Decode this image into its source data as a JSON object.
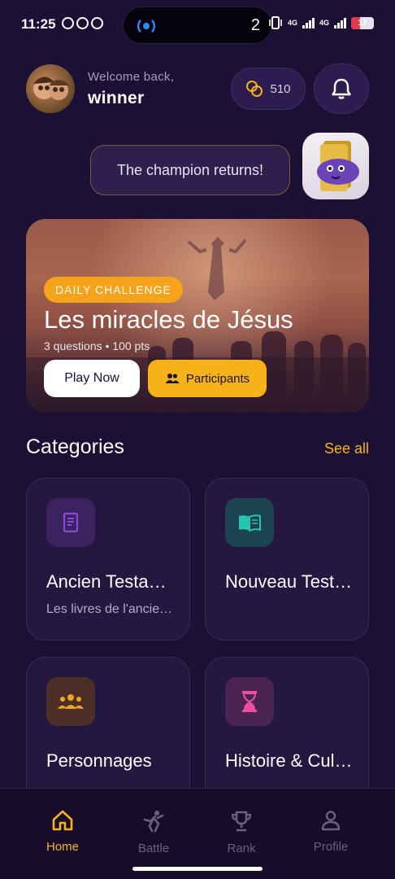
{
  "status_bar": {
    "time": "11:25",
    "island_count": "2",
    "net_1": "4G",
    "net_2": "4G",
    "battery": "17"
  },
  "header": {
    "welcome": "Welcome back,",
    "username": "winner",
    "coins": "510"
  },
  "speech": {
    "text": "The champion returns!"
  },
  "challenge": {
    "badge": "DAILY CHALLENGE",
    "title": "Les miracles de Jésus",
    "subtitle": "3 questions • 100 pts",
    "play_label": "Play Now",
    "participants_label": "Participants"
  },
  "categories": {
    "title": "Categories",
    "see_all": "See all",
    "items": [
      {
        "name": "Ancien Testament",
        "desc": "Les livres de l'ancien testament",
        "icon": "scroll-icon",
        "color": "#8b4bd8",
        "bg": "#3b2260"
      },
      {
        "name": "Nouveau Testament",
        "desc": "",
        "icon": "book-icon",
        "color": "#26c6b0",
        "bg": "#1c4450"
      },
      {
        "name": "Personnages",
        "desc": "",
        "icon": "group-icon",
        "color": "#f4a51c",
        "bg": "#4c3028"
      },
      {
        "name": "Histoire & Culture",
        "desc": "",
        "icon": "hourglass-icon",
        "color": "#ec4fa0",
        "bg": "#4a2452"
      }
    ]
  },
  "nav": {
    "items": [
      {
        "label": "Home",
        "icon": "home-icon",
        "active": true
      },
      {
        "label": "Battle",
        "icon": "battle-icon",
        "active": false
      },
      {
        "label": "Rank",
        "icon": "trophy-icon",
        "active": false
      },
      {
        "label": "Profile",
        "icon": "profile-icon",
        "active": false
      }
    ],
    "active_color": "#f7b21a",
    "inactive_color": "#6a6082"
  }
}
